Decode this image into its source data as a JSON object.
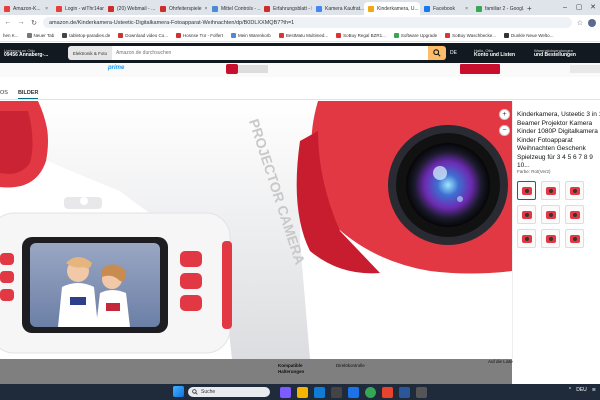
{
  "browser": {
    "tabs": [
      {
        "label": "Amazon-K...",
        "color": "#e83d3d"
      },
      {
        "label": "Login - wiThr14an",
        "color": "#e83d3d"
      },
      {
        "label": "(20) Webmail - ...",
        "color": "#d02b2b"
      },
      {
        "label": "Ohrfeiterspiele",
        "color": "#d02b2b"
      },
      {
        "label": "Mittel Controls - ...",
        "color": "#4a8bd6"
      },
      {
        "label": "Erfahrungsblatt - R...",
        "color": "#d02b2b"
      },
      {
        "label": "Kamera Kaufrat...",
        "color": "#4285f4"
      },
      {
        "label": "Kinderkamera, U...",
        "color": "#f3a712",
        "active": true
      },
      {
        "label": "Facebook",
        "color": "#1877f2"
      },
      {
        "label": "familiar 2 - Googl...",
        "color": "#34a853"
      }
    ],
    "new_tab_label": "+",
    "url": "amazon.de/Kinderkamera-Usteetic-Digitalkamera-Fotoapparat-Weihnachten/dp/B0DLXXMQB7?th=1",
    "bookmarks": [
      {
        "label": "Neuer Tab",
        "color": "#777"
      },
      {
        "label": "tabletop-paradies.de",
        "color": "#444"
      },
      {
        "label": "Download video Co...",
        "color": "#c33"
      },
      {
        "label": "Hosnse Tür - Folfert",
        "color": "#c33"
      },
      {
        "label": "Mein Warenkorb",
        "color": "#4a8bd6"
      },
      {
        "label": "BestMatu Multimed...",
        "color": "#d33"
      },
      {
        "label": "SoBuy Regal BZR1...",
        "color": "#d33"
      },
      {
        "label": "Software Upgrade",
        "color": "#34a853"
      },
      {
        "label": "SoBuy Waschbecke...",
        "color": "#d33"
      },
      {
        "label": "Dunkle Neue Welto...",
        "color": "#333"
      }
    ],
    "bookmark_first": "hen K..."
  },
  "amazon": {
    "deliver_line1": "Lieferung an Otto",
    "deliver_line2": "09456 Annaberg-...",
    "search_category": "Elektronik & Foto",
    "search_placeholder": "Amazon.de durchsuchen",
    "lang": "DE",
    "account_line1": "Hallo, Otto",
    "account_line2": "Konto und Listen",
    "orders_line1": "Warenrücksendungen",
    "orders_line2": "und Bestellungen",
    "prime_label": "prime"
  },
  "media_tabs": [
    "OS",
    "BILDER"
  ],
  "product": {
    "title": "Kinderkamera, Usteetic 3 in 1 Beamer Projektor Kamera Kinder 1080P Digitalkamera Kinder Fotoapparat Weihnachten Geschenk Spielzeug für 3 4 5 6 7 8 9 10...",
    "color_label": "Farbe: Rot(Ver2)",
    "image_text": "PROJECTOR CAMERA",
    "zoom_in_label": "+",
    "zoom_out_label": "−",
    "thumbs_count": 9,
    "accent_red": "#e23844"
  },
  "page_under": {
    "col1": [
      "Kompatible",
      "Halterungen"
    ],
    "col2": "Direktkontrolle",
    "col3": "Auf die Liste"
  },
  "taskbar": {
    "search_label": "Suche",
    "tray_text": "DEU"
  }
}
